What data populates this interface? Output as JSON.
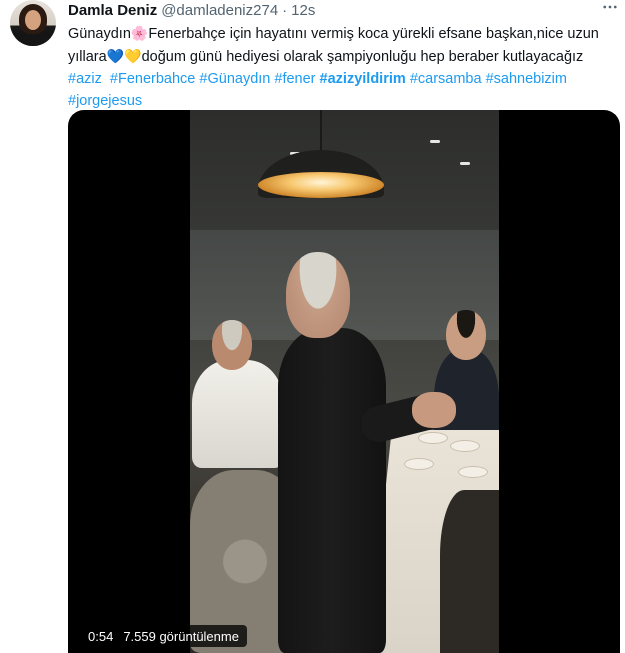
{
  "author": {
    "name": "Damla Deniz",
    "handle": "@damladeniz274",
    "separator": "·",
    "time": "12s",
    "more_icon": "more-horizontal-icon"
  },
  "tweet": {
    "line1_pre": "Günaydın",
    "line1_post": "Fenerbahçe için hayatını vermiş koca yürekli  efsane başkan,nice uzun",
    "line2_pre": "yıllara",
    "line2_post": "doğum günü hediyesi olarak şampiyonluğu hep beraber kutlayacağız",
    "emojis": {
      "flower": "🌸",
      "blue_heart": "💙",
      "yellow_heart": "💛"
    },
    "hashtags": [
      {
        "text": "#aziz",
        "bold": false
      },
      {
        "text": "#Fenerbahce",
        "bold": false
      },
      {
        "text": "#Günaydın",
        "bold": false
      },
      {
        "text": "#fener",
        "bold": false
      },
      {
        "text": "#azizyildirim",
        "bold": true
      },
      {
        "text": "#carsamba",
        "bold": false
      },
      {
        "text": "#sahnebizim",
        "bold": false
      },
      {
        "text": "#jorgejesus",
        "bold": false
      }
    ]
  },
  "video": {
    "duration": "0:54",
    "views": "7.559 görüntülenme"
  },
  "colors": {
    "link": "#1d9bf0",
    "secondary_text": "#536471",
    "primary_text": "#0f1419"
  }
}
